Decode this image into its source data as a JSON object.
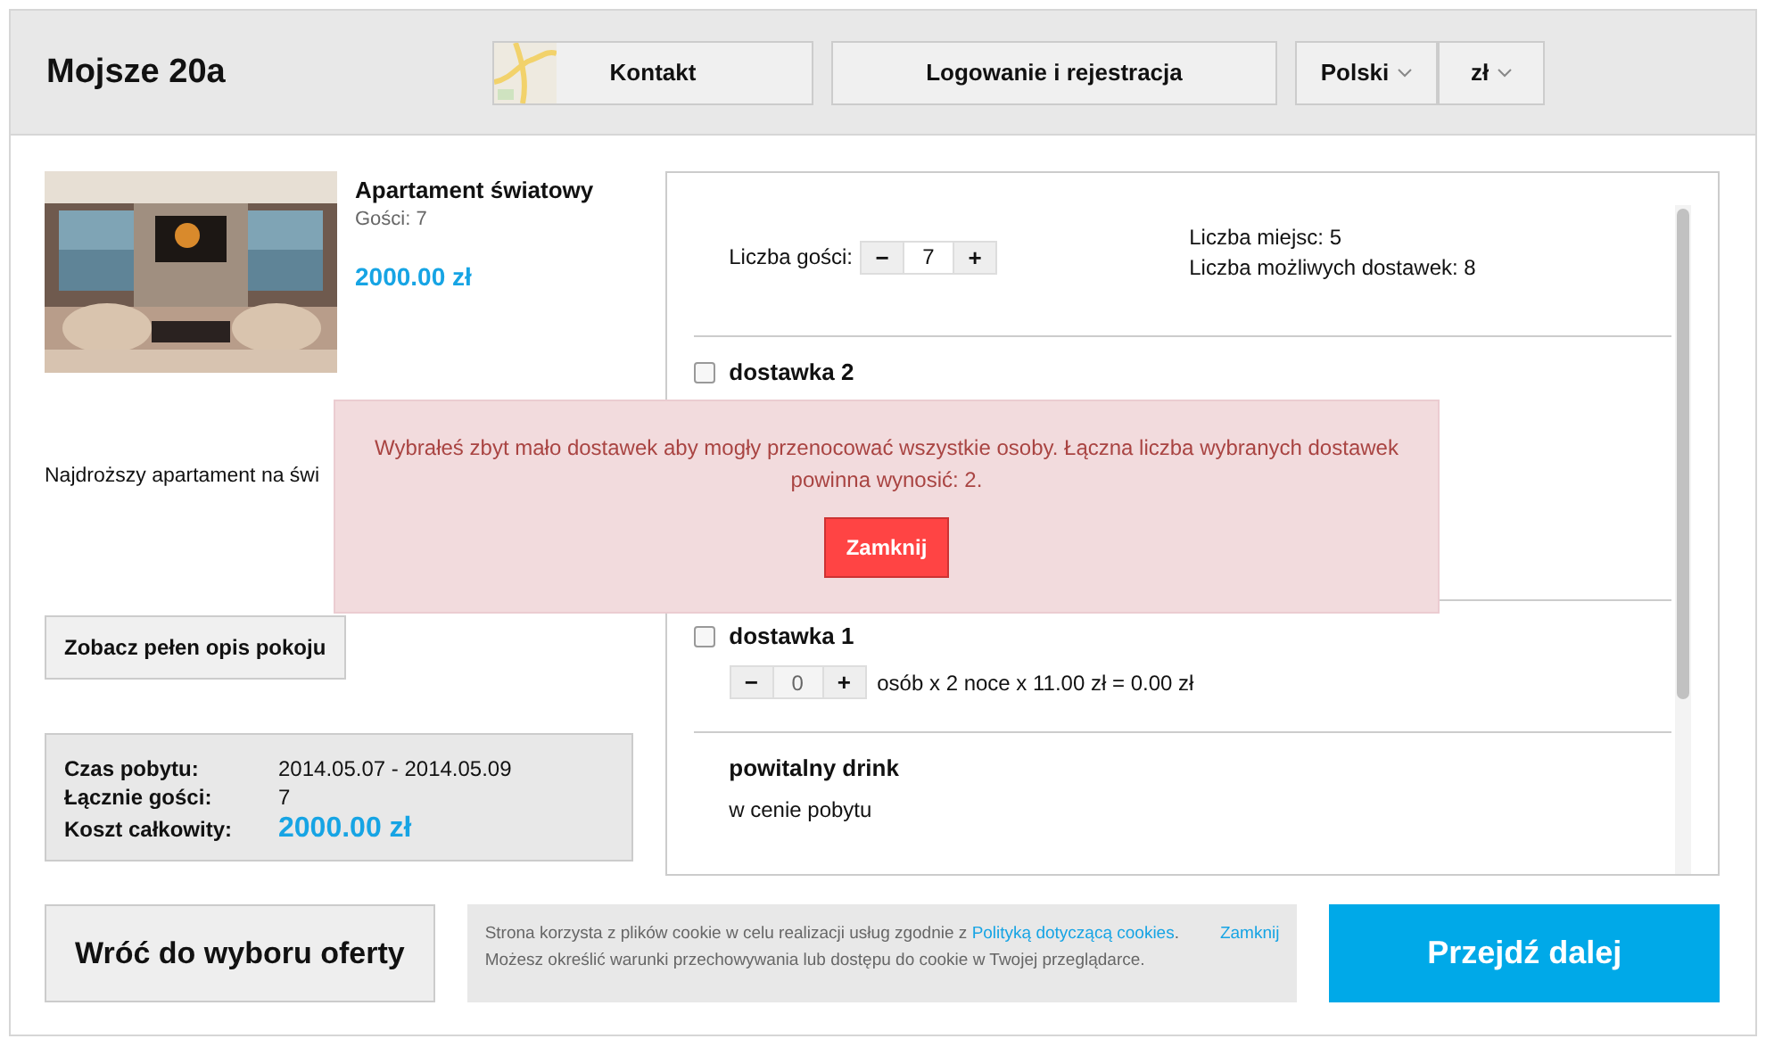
{
  "header": {
    "title": "Mojsze 20a",
    "contact_button": "Kontakt",
    "login_button": "Logowanie i rejestracja",
    "language": "Polski",
    "currency": "zł"
  },
  "room": {
    "name": "Apartament światowy",
    "guests": "Gości: 7",
    "price": "2000.00 zł",
    "description": "Najdroższy apartament na świ",
    "details_button": "Zobacz pełen opis pokoju"
  },
  "summary": [
    {
      "kind": "text",
      "label": "Czas pobytu:",
      "value": "2014.05.07 - 2014.05.09"
    },
    {
      "kind": "text",
      "label": "Łącznie gości:",
      "value": "7"
    },
    {
      "kind": "price",
      "label": "Koszt całkowity:",
      "value": "2000.00 zł"
    }
  ],
  "booking": {
    "guests_label": "Liczba gości:",
    "guests_value": "7",
    "minus": "−",
    "plus": "+",
    "seats": "Liczba miejsc: 5",
    "possible_extras": "Liczba możliwych dostawek: 8"
  },
  "extras": [
    {
      "kind": "extra",
      "name": "dostawka 2",
      "checked": false
    },
    {
      "kind": "extra",
      "name": "dostawka 1",
      "checked": false,
      "qty": "0",
      "minus": "−",
      "plus": "+",
      "details": "osób  x 2  noce x 11.00 zł = 0.00 zł"
    },
    {
      "kind": "included",
      "name": "powitalny drink",
      "note": "w cenie pobytu"
    }
  ],
  "alert": {
    "message": "Wybrałeś zbyt mało dostawek aby mogły przenocować wszystkie osoby. Łączna liczba wybranych dostawek powinna wynosić: 2.",
    "button": "Zamknij"
  },
  "footer": {
    "back_button": "Wróć do wyboru oferty",
    "cookie": {
      "text_before": "Strona korzysta z plików cookie w celu realizacji usług zgodnie z ",
      "link": "Polityką dotyczącą cookies",
      "text_after": ".",
      "second_line": "Możesz określić warunki przechowywania lub dostępu do cookie w Twojej przeglądarce.",
      "close": "Zamknij"
    },
    "next_button": "Przejdź dalej"
  }
}
